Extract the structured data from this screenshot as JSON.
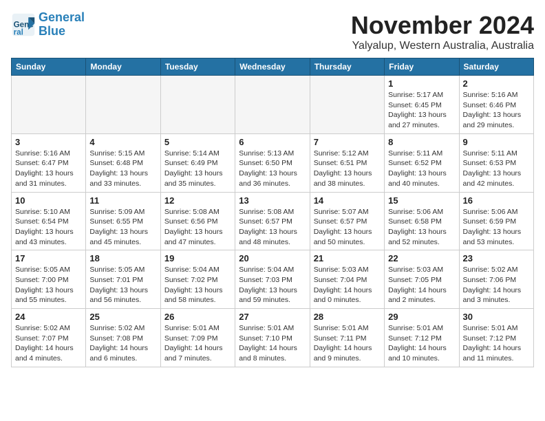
{
  "header": {
    "logo_line1": "General",
    "logo_line2": "Blue",
    "month_title": "November 2024",
    "location": "Yalyalup, Western Australia, Australia"
  },
  "weekdays": [
    "Sunday",
    "Monday",
    "Tuesday",
    "Wednesday",
    "Thursday",
    "Friday",
    "Saturday"
  ],
  "weeks": [
    [
      {
        "day": "",
        "info": ""
      },
      {
        "day": "",
        "info": ""
      },
      {
        "day": "",
        "info": ""
      },
      {
        "day": "",
        "info": ""
      },
      {
        "day": "",
        "info": ""
      },
      {
        "day": "1",
        "info": "Sunrise: 5:17 AM\nSunset: 6:45 PM\nDaylight: 13 hours\nand 27 minutes."
      },
      {
        "day": "2",
        "info": "Sunrise: 5:16 AM\nSunset: 6:46 PM\nDaylight: 13 hours\nand 29 minutes."
      }
    ],
    [
      {
        "day": "3",
        "info": "Sunrise: 5:16 AM\nSunset: 6:47 PM\nDaylight: 13 hours\nand 31 minutes."
      },
      {
        "day": "4",
        "info": "Sunrise: 5:15 AM\nSunset: 6:48 PM\nDaylight: 13 hours\nand 33 minutes."
      },
      {
        "day": "5",
        "info": "Sunrise: 5:14 AM\nSunset: 6:49 PM\nDaylight: 13 hours\nand 35 minutes."
      },
      {
        "day": "6",
        "info": "Sunrise: 5:13 AM\nSunset: 6:50 PM\nDaylight: 13 hours\nand 36 minutes."
      },
      {
        "day": "7",
        "info": "Sunrise: 5:12 AM\nSunset: 6:51 PM\nDaylight: 13 hours\nand 38 minutes."
      },
      {
        "day": "8",
        "info": "Sunrise: 5:11 AM\nSunset: 6:52 PM\nDaylight: 13 hours\nand 40 minutes."
      },
      {
        "day": "9",
        "info": "Sunrise: 5:11 AM\nSunset: 6:53 PM\nDaylight: 13 hours\nand 42 minutes."
      }
    ],
    [
      {
        "day": "10",
        "info": "Sunrise: 5:10 AM\nSunset: 6:54 PM\nDaylight: 13 hours\nand 43 minutes."
      },
      {
        "day": "11",
        "info": "Sunrise: 5:09 AM\nSunset: 6:55 PM\nDaylight: 13 hours\nand 45 minutes."
      },
      {
        "day": "12",
        "info": "Sunrise: 5:08 AM\nSunset: 6:56 PM\nDaylight: 13 hours\nand 47 minutes."
      },
      {
        "day": "13",
        "info": "Sunrise: 5:08 AM\nSunset: 6:57 PM\nDaylight: 13 hours\nand 48 minutes."
      },
      {
        "day": "14",
        "info": "Sunrise: 5:07 AM\nSunset: 6:57 PM\nDaylight: 13 hours\nand 50 minutes."
      },
      {
        "day": "15",
        "info": "Sunrise: 5:06 AM\nSunset: 6:58 PM\nDaylight: 13 hours\nand 52 minutes."
      },
      {
        "day": "16",
        "info": "Sunrise: 5:06 AM\nSunset: 6:59 PM\nDaylight: 13 hours\nand 53 minutes."
      }
    ],
    [
      {
        "day": "17",
        "info": "Sunrise: 5:05 AM\nSunset: 7:00 PM\nDaylight: 13 hours\nand 55 minutes."
      },
      {
        "day": "18",
        "info": "Sunrise: 5:05 AM\nSunset: 7:01 PM\nDaylight: 13 hours\nand 56 minutes."
      },
      {
        "day": "19",
        "info": "Sunrise: 5:04 AM\nSunset: 7:02 PM\nDaylight: 13 hours\nand 58 minutes."
      },
      {
        "day": "20",
        "info": "Sunrise: 5:04 AM\nSunset: 7:03 PM\nDaylight: 13 hours\nand 59 minutes."
      },
      {
        "day": "21",
        "info": "Sunrise: 5:03 AM\nSunset: 7:04 PM\nDaylight: 14 hours\nand 0 minutes."
      },
      {
        "day": "22",
        "info": "Sunrise: 5:03 AM\nSunset: 7:05 PM\nDaylight: 14 hours\nand 2 minutes."
      },
      {
        "day": "23",
        "info": "Sunrise: 5:02 AM\nSunset: 7:06 PM\nDaylight: 14 hours\nand 3 minutes."
      }
    ],
    [
      {
        "day": "24",
        "info": "Sunrise: 5:02 AM\nSunset: 7:07 PM\nDaylight: 14 hours\nand 4 minutes."
      },
      {
        "day": "25",
        "info": "Sunrise: 5:02 AM\nSunset: 7:08 PM\nDaylight: 14 hours\nand 6 minutes."
      },
      {
        "day": "26",
        "info": "Sunrise: 5:01 AM\nSunset: 7:09 PM\nDaylight: 14 hours\nand 7 minutes."
      },
      {
        "day": "27",
        "info": "Sunrise: 5:01 AM\nSunset: 7:10 PM\nDaylight: 14 hours\nand 8 minutes."
      },
      {
        "day": "28",
        "info": "Sunrise: 5:01 AM\nSunset: 7:11 PM\nDaylight: 14 hours\nand 9 minutes."
      },
      {
        "day": "29",
        "info": "Sunrise: 5:01 AM\nSunset: 7:12 PM\nDaylight: 14 hours\nand 10 minutes."
      },
      {
        "day": "30",
        "info": "Sunrise: 5:01 AM\nSunset: 7:12 PM\nDaylight: 14 hours\nand 11 minutes."
      }
    ]
  ]
}
